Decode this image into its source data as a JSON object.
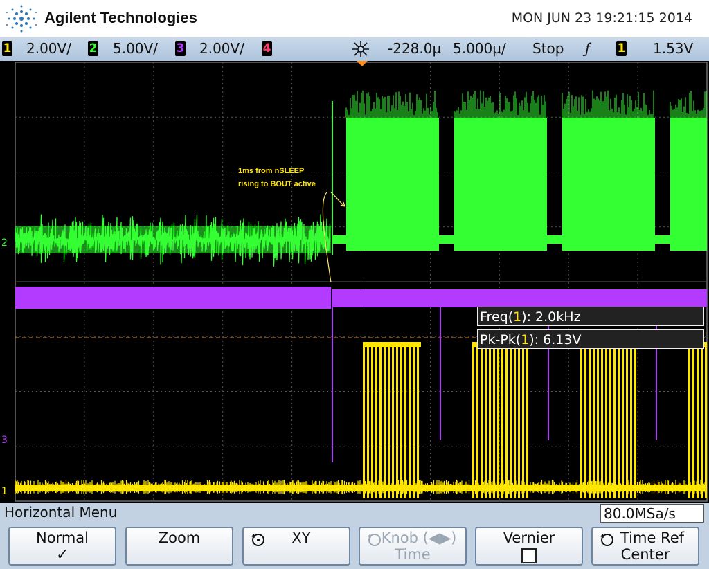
{
  "header": {
    "brand": "Agilent Technologies",
    "datetime": "MON JUN 23 19:21:15 2014"
  },
  "status": {
    "ch1": {
      "num": "1",
      "scale": "2.00V/",
      "color": "#ffe600"
    },
    "ch2": {
      "num": "2",
      "scale": "5.00V/",
      "color": "#33ff33"
    },
    "ch3": {
      "num": "3",
      "scale": "2.00V/",
      "color": "#b23bff"
    },
    "ch4": {
      "num": "4",
      "color": "#ff3b6a"
    },
    "delay": "-228.0µ",
    "timebase": "5.000µ/",
    "run_state": "Stop",
    "trigger_edge_glyph": "ƒ",
    "trigger_source": "1",
    "trigger_level": "1.53V"
  },
  "screen": {
    "annotation_line1": "1ms from nSLEEP",
    "annotation_line2": "rising to BOUT active",
    "ch2_marker": "2",
    "ch3_marker": "3",
    "ch1_marker": "1",
    "measurements": [
      {
        "name": "Freq(",
        "src": "1",
        "value": "): 2.0kHz"
      },
      {
        "name": "Pk-Pk(",
        "src": "1",
        "value": "): 6.13V"
      }
    ]
  },
  "menu": {
    "title": "Horizontal Menu",
    "sample_rate": "80.0MSa/s",
    "softkeys": [
      {
        "line1": "Normal",
        "line2": "✓"
      },
      {
        "line1": "Zoom",
        "line2": ""
      },
      {
        "line1": "XY",
        "line2": ""
      },
      {
        "line1": "Knob (◀▶)",
        "line2": "Time"
      },
      {
        "line1": "Vernier",
        "line2": ""
      },
      {
        "line1": "Time Ref",
        "line2": "Center"
      }
    ]
  }
}
